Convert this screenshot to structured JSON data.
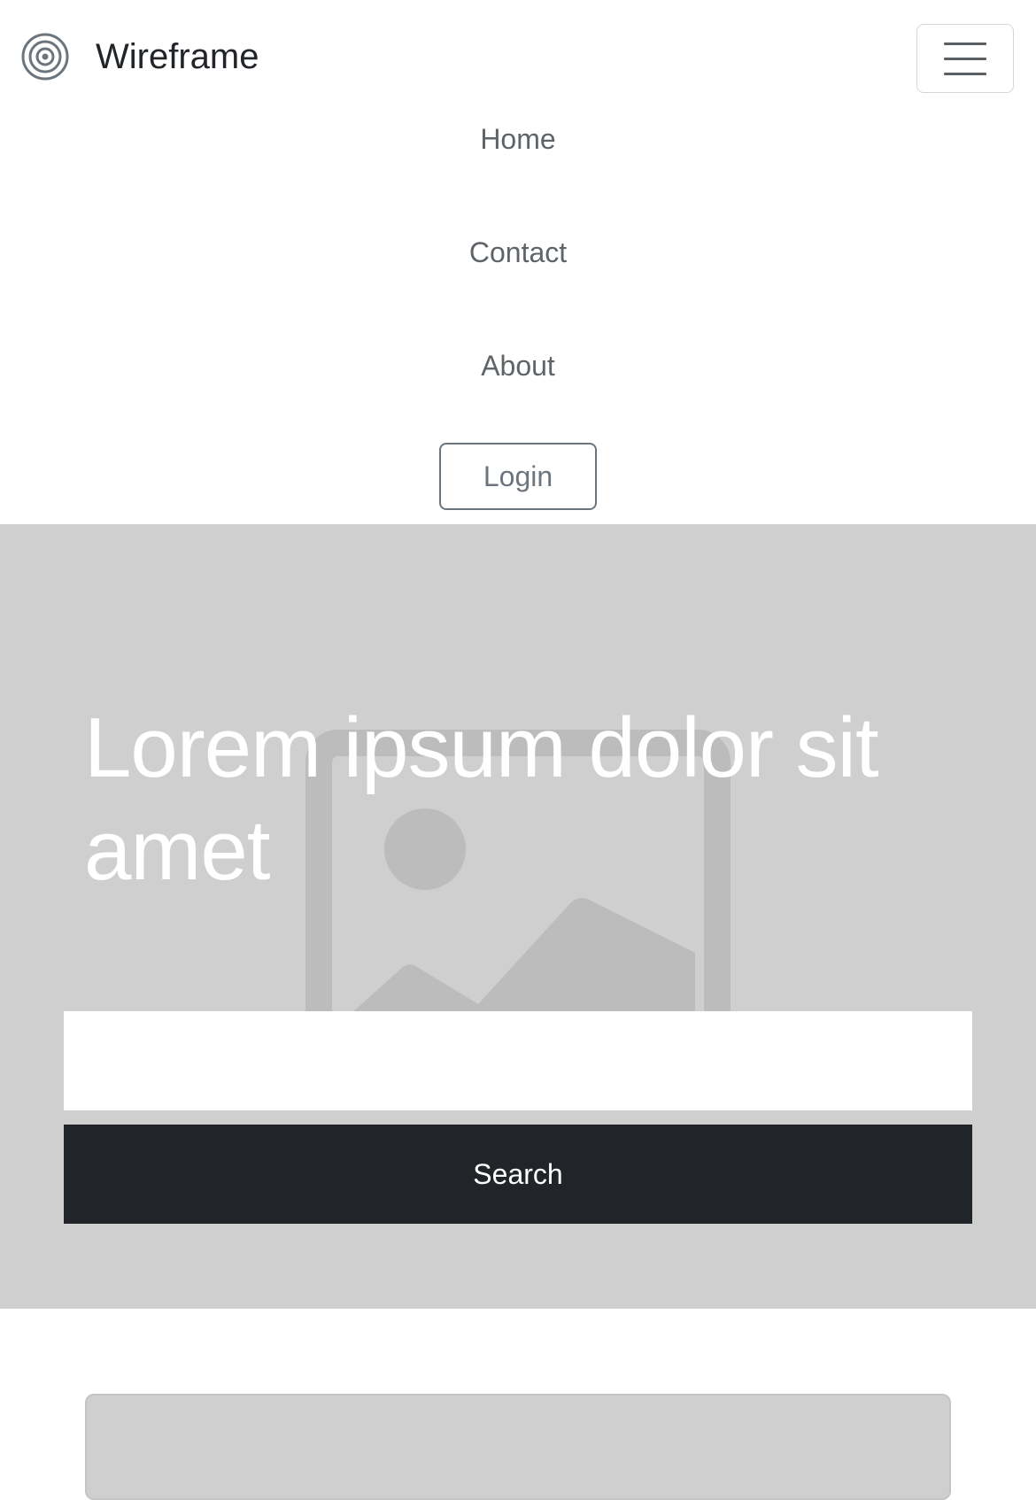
{
  "navbar": {
    "brand_text": "Wireframe",
    "brand_icon": "target-rings-icon",
    "toggler_icon": "hamburger-menu-icon",
    "links": [
      {
        "label": "Home"
      },
      {
        "label": "Contact"
      },
      {
        "label": "About"
      }
    ],
    "login_label": "Login"
  },
  "hero": {
    "title": "Lorem ipsum dolor sit amet",
    "background_icon": "image-placeholder-icon",
    "search": {
      "value": "",
      "placeholder": "",
      "button_label": "Search"
    }
  },
  "colors": {
    "hero_background": "#cfcfcf",
    "search_button": "#212529",
    "nav_text": "#5f6468",
    "login_border": "#6c757d"
  }
}
